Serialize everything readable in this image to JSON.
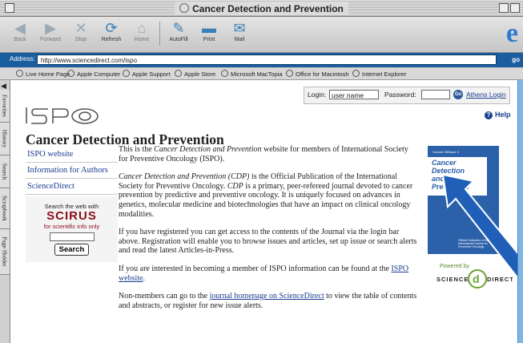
{
  "window": {
    "title": "Cancer Detection and Prevention"
  },
  "toolbar": {
    "buttons": [
      {
        "label": "Back",
        "icon": "back-arrow-icon",
        "glyph": "◀"
      },
      {
        "label": "Forward",
        "icon": "forward-arrow-icon",
        "glyph": "▶"
      },
      {
        "label": "Stop",
        "icon": "stop-icon",
        "glyph": "✕"
      },
      {
        "label": "Refresh",
        "icon": "refresh-icon",
        "glyph": "⟳"
      },
      {
        "label": "Home",
        "icon": "home-icon",
        "glyph": "⌂"
      },
      {
        "label": "AutoFill",
        "icon": "autofill-icon",
        "glyph": "✎"
      },
      {
        "label": "Print",
        "icon": "print-icon",
        "glyph": "▬"
      },
      {
        "label": "Mail",
        "icon": "mail-icon",
        "glyph": "✉"
      }
    ],
    "logo_glyph": "e"
  },
  "address": {
    "label": "Address:",
    "url": "http://www.sciencedirect.com/ispo",
    "go": "go"
  },
  "favorites": [
    "Live Home Page",
    "Apple Computer",
    "Apple Support",
    "Apple Store",
    "Microsoft MacTopia",
    "Office for Macintosh",
    "Internet Explorer"
  ],
  "side_tabs": [
    "Favorites",
    "History",
    "Search",
    "Scrapbook",
    "Page Holder"
  ],
  "login": {
    "login_label": "Login:",
    "username_value": "user name",
    "password_label": "Password:",
    "go_label": "Go",
    "athens_label": "Athens Login"
  },
  "help": {
    "label": "Help",
    "glyph": "?"
  },
  "page_title": "Cancer Detection and Prevention",
  "nav": [
    "ISPO website",
    "Information for Authors",
    "ScienceDirect"
  ],
  "scirus": {
    "label": "Search the web with",
    "logo": "SCIRUS",
    "tagline": "for scientific info only",
    "button": "Search"
  },
  "main": {
    "p1_a": "This is the ",
    "p1_em": "Cancer Detection and Prevention",
    "p1_b": " website for members of International Society for Preventive Oncology (ISPO).",
    "p2_em1": "Cancer Detection and Prevention (CDP)",
    "p2_a": " is the Official Publication of the International Society for Preventive Oncology. ",
    "p2_em2": "CDP",
    "p2_b": " is a primary, peer-refereed journal devoted to cancer prevention by predictive and preventive oncology. It is uniquely focused on advances in genetics, molecular medicine and biotechnologies that have an impact on clinical oncology modalities.",
    "p3": "If you have registered you can get access to the contents of the Journal via the login bar above. Registration will enable you to browse issues and articles, set up issue or search alerts and read the latest Articles-in-Press.",
    "p4_a": "If you are interested in becoming a member of ISPO information can be found at the ",
    "p4_link": "ISPO website",
    "p4_b": ".",
    "p5_a": "Non-members can go to the ",
    "p5_link": "journal homepage on ScienceDirect",
    "p5_b": " to view the table of contents and abstracts, or register for new issue alerts."
  },
  "cover": {
    "volume": "Volume 28/Issue 4",
    "title_lines": [
      "Cancer",
      "Detection",
      "and",
      "Prevention"
    ],
    "bottom_text": "Official Publication of the International Society for Preventive Oncology"
  },
  "powered": {
    "label": "Powered by",
    "logo": "SCIENCE DIRECT",
    "logo_left": "SCIENCE",
    "logo_right": "DIRECT"
  },
  "colors": {
    "address_bar": "#1a5ea0",
    "link": "#1a3c8f",
    "cover": "#2b61a8",
    "scirus": "#8b0f1a",
    "annotation_arrow": "#1f5fb8"
  }
}
